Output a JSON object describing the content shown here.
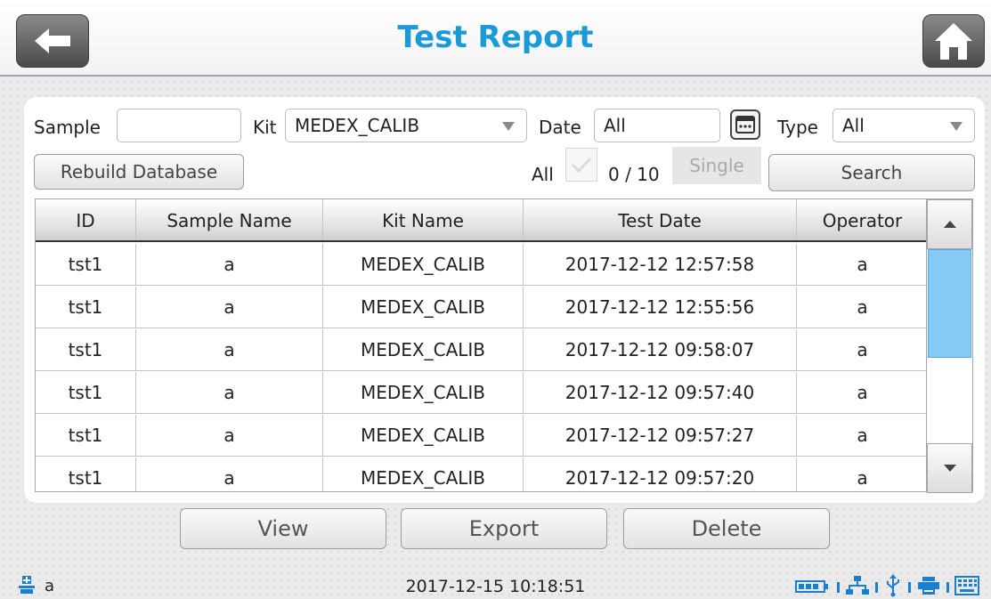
{
  "header": {
    "title": "Test Report",
    "back_icon": "back-arrow-icon",
    "home_icon": "home-icon"
  },
  "filters": {
    "sample_label": "Sample",
    "sample_value": "",
    "kit_label": "Kit",
    "kit_value": "MEDEX_CALIB",
    "date_label": "Date",
    "date_value": "All",
    "type_label": "Type",
    "type_value": "All"
  },
  "toolbar": {
    "rebuild_label": "Rebuild Database",
    "all_label": "All",
    "selection_count": "0 / 10",
    "single_label": "Single",
    "search_label": "Search"
  },
  "table": {
    "columns": [
      "ID",
      "Sample Name",
      "Kit Name",
      "Test Date",
      "Operator"
    ],
    "rows": [
      [
        "tst1",
        "a",
        "MEDEX_CALIB",
        "2017-12-12 12:57:58",
        "a"
      ],
      [
        "tst1",
        "a",
        "MEDEX_CALIB",
        "2017-12-12 12:55:56",
        "a"
      ],
      [
        "tst1",
        "a",
        "MEDEX_CALIB",
        "2017-12-12 09:58:07",
        "a"
      ],
      [
        "tst1",
        "a",
        "MEDEX_CALIB",
        "2017-12-12 09:57:40",
        "a"
      ],
      [
        "tst1",
        "a",
        "MEDEX_CALIB",
        "2017-12-12 09:57:27",
        "a"
      ],
      [
        "tst1",
        "a",
        "MEDEX_CALIB",
        "2017-12-12 09:57:20",
        "a"
      ]
    ],
    "scroll_fraction": 0.56
  },
  "actions": {
    "view_label": "View",
    "export_label": "Export",
    "delete_label": "Delete"
  },
  "status": {
    "user": "a",
    "datetime": "2017-12-15 10:18:51",
    "icons": [
      "user-icon",
      "battery-icon",
      "network-icon",
      "usb-icon",
      "printer-icon",
      "keyboard-icon"
    ]
  },
  "colors": {
    "accent": "#1a9bd8",
    "scroll_thumb": "#86c9f5",
    "status_icons": "#1a7fd0"
  }
}
